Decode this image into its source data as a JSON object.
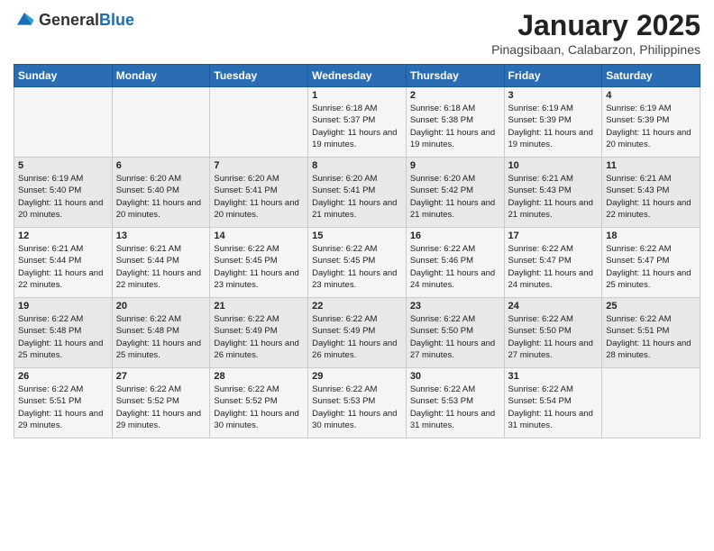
{
  "header": {
    "logo_general": "General",
    "logo_blue": "Blue",
    "main_title": "January 2025",
    "subtitle": "Pinagsibaan, Calabarzon, Philippines"
  },
  "weekdays": [
    "Sunday",
    "Monday",
    "Tuesday",
    "Wednesday",
    "Thursday",
    "Friday",
    "Saturday"
  ],
  "weeks": [
    [
      {
        "day": "",
        "sunrise": "",
        "sunset": "",
        "daylight": ""
      },
      {
        "day": "",
        "sunrise": "",
        "sunset": "",
        "daylight": ""
      },
      {
        "day": "",
        "sunrise": "",
        "sunset": "",
        "daylight": ""
      },
      {
        "day": "1",
        "sunrise": "Sunrise: 6:18 AM",
        "sunset": "Sunset: 5:37 PM",
        "daylight": "Daylight: 11 hours and 19 minutes."
      },
      {
        "day": "2",
        "sunrise": "Sunrise: 6:18 AM",
        "sunset": "Sunset: 5:38 PM",
        "daylight": "Daylight: 11 hours and 19 minutes."
      },
      {
        "day": "3",
        "sunrise": "Sunrise: 6:19 AM",
        "sunset": "Sunset: 5:39 PM",
        "daylight": "Daylight: 11 hours and 19 minutes."
      },
      {
        "day": "4",
        "sunrise": "Sunrise: 6:19 AM",
        "sunset": "Sunset: 5:39 PM",
        "daylight": "Daylight: 11 hours and 20 minutes."
      }
    ],
    [
      {
        "day": "5",
        "sunrise": "Sunrise: 6:19 AM",
        "sunset": "Sunset: 5:40 PM",
        "daylight": "Daylight: 11 hours and 20 minutes."
      },
      {
        "day": "6",
        "sunrise": "Sunrise: 6:20 AM",
        "sunset": "Sunset: 5:40 PM",
        "daylight": "Daylight: 11 hours and 20 minutes."
      },
      {
        "day": "7",
        "sunrise": "Sunrise: 6:20 AM",
        "sunset": "Sunset: 5:41 PM",
        "daylight": "Daylight: 11 hours and 20 minutes."
      },
      {
        "day": "8",
        "sunrise": "Sunrise: 6:20 AM",
        "sunset": "Sunset: 5:41 PM",
        "daylight": "Daylight: 11 hours and 21 minutes."
      },
      {
        "day": "9",
        "sunrise": "Sunrise: 6:20 AM",
        "sunset": "Sunset: 5:42 PM",
        "daylight": "Daylight: 11 hours and 21 minutes."
      },
      {
        "day": "10",
        "sunrise": "Sunrise: 6:21 AM",
        "sunset": "Sunset: 5:43 PM",
        "daylight": "Daylight: 11 hours and 21 minutes."
      },
      {
        "day": "11",
        "sunrise": "Sunrise: 6:21 AM",
        "sunset": "Sunset: 5:43 PM",
        "daylight": "Daylight: 11 hours and 22 minutes."
      }
    ],
    [
      {
        "day": "12",
        "sunrise": "Sunrise: 6:21 AM",
        "sunset": "Sunset: 5:44 PM",
        "daylight": "Daylight: 11 hours and 22 minutes."
      },
      {
        "day": "13",
        "sunrise": "Sunrise: 6:21 AM",
        "sunset": "Sunset: 5:44 PM",
        "daylight": "Daylight: 11 hours and 22 minutes."
      },
      {
        "day": "14",
        "sunrise": "Sunrise: 6:22 AM",
        "sunset": "Sunset: 5:45 PM",
        "daylight": "Daylight: 11 hours and 23 minutes."
      },
      {
        "day": "15",
        "sunrise": "Sunrise: 6:22 AM",
        "sunset": "Sunset: 5:45 PM",
        "daylight": "Daylight: 11 hours and 23 minutes."
      },
      {
        "day": "16",
        "sunrise": "Sunrise: 6:22 AM",
        "sunset": "Sunset: 5:46 PM",
        "daylight": "Daylight: 11 hours and 24 minutes."
      },
      {
        "day": "17",
        "sunrise": "Sunrise: 6:22 AM",
        "sunset": "Sunset: 5:47 PM",
        "daylight": "Daylight: 11 hours and 24 minutes."
      },
      {
        "day": "18",
        "sunrise": "Sunrise: 6:22 AM",
        "sunset": "Sunset: 5:47 PM",
        "daylight": "Daylight: 11 hours and 25 minutes."
      }
    ],
    [
      {
        "day": "19",
        "sunrise": "Sunrise: 6:22 AM",
        "sunset": "Sunset: 5:48 PM",
        "daylight": "Daylight: 11 hours and 25 minutes."
      },
      {
        "day": "20",
        "sunrise": "Sunrise: 6:22 AM",
        "sunset": "Sunset: 5:48 PM",
        "daylight": "Daylight: 11 hours and 25 minutes."
      },
      {
        "day": "21",
        "sunrise": "Sunrise: 6:22 AM",
        "sunset": "Sunset: 5:49 PM",
        "daylight": "Daylight: 11 hours and 26 minutes."
      },
      {
        "day": "22",
        "sunrise": "Sunrise: 6:22 AM",
        "sunset": "Sunset: 5:49 PM",
        "daylight": "Daylight: 11 hours and 26 minutes."
      },
      {
        "day": "23",
        "sunrise": "Sunrise: 6:22 AM",
        "sunset": "Sunset: 5:50 PM",
        "daylight": "Daylight: 11 hours and 27 minutes."
      },
      {
        "day": "24",
        "sunrise": "Sunrise: 6:22 AM",
        "sunset": "Sunset: 5:50 PM",
        "daylight": "Daylight: 11 hours and 27 minutes."
      },
      {
        "day": "25",
        "sunrise": "Sunrise: 6:22 AM",
        "sunset": "Sunset: 5:51 PM",
        "daylight": "Daylight: 11 hours and 28 minutes."
      }
    ],
    [
      {
        "day": "26",
        "sunrise": "Sunrise: 6:22 AM",
        "sunset": "Sunset: 5:51 PM",
        "daylight": "Daylight: 11 hours and 29 minutes."
      },
      {
        "day": "27",
        "sunrise": "Sunrise: 6:22 AM",
        "sunset": "Sunset: 5:52 PM",
        "daylight": "Daylight: 11 hours and 29 minutes."
      },
      {
        "day": "28",
        "sunrise": "Sunrise: 6:22 AM",
        "sunset": "Sunset: 5:52 PM",
        "daylight": "Daylight: 11 hours and 30 minutes."
      },
      {
        "day": "29",
        "sunrise": "Sunrise: 6:22 AM",
        "sunset": "Sunset: 5:53 PM",
        "daylight": "Daylight: 11 hours and 30 minutes."
      },
      {
        "day": "30",
        "sunrise": "Sunrise: 6:22 AM",
        "sunset": "Sunset: 5:53 PM",
        "daylight": "Daylight: 11 hours and 31 minutes."
      },
      {
        "day": "31",
        "sunrise": "Sunrise: 6:22 AM",
        "sunset": "Sunset: 5:54 PM",
        "daylight": "Daylight: 11 hours and 31 minutes."
      },
      {
        "day": "",
        "sunrise": "",
        "sunset": "",
        "daylight": ""
      }
    ]
  ]
}
